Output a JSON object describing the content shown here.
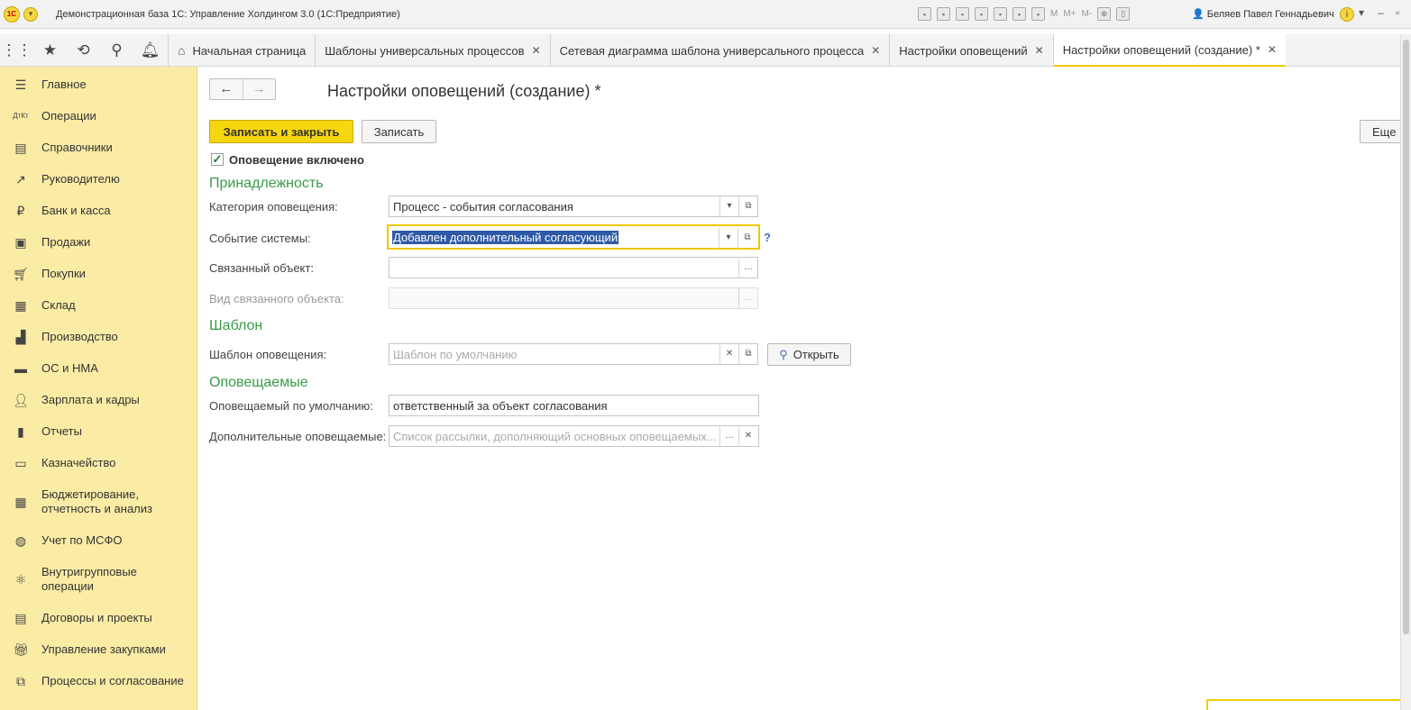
{
  "app": {
    "title": "Демонстрационная база 1С: Управление Холдингом 3.0  (1С:Предприятие)",
    "user": "Беляев Павел Геннадьевич",
    "logo_text": "1С",
    "toolbar_m": [
      "M",
      "M+",
      "M-"
    ]
  },
  "tabs": [
    {
      "label": "Начальная страница"
    },
    {
      "label": "Шаблоны универсальных процессов"
    },
    {
      "label": "Сетевая диаграмма шаблона универсального процесса"
    },
    {
      "label": "Настройки оповещений"
    },
    {
      "label": "Настройки оповещений (создание) *"
    }
  ],
  "sidebar": {
    "items": [
      {
        "label": "Главное",
        "icon": "menu-icon"
      },
      {
        "label": "Операции",
        "icon": "dt-kt-icon"
      },
      {
        "label": "Справочники",
        "icon": "book-icon"
      },
      {
        "label": "Руководителю",
        "icon": "trend-icon"
      },
      {
        "label": "Банк и касса",
        "icon": "ruble-icon"
      },
      {
        "label": "Продажи",
        "icon": "bag-icon"
      },
      {
        "label": "Покупки",
        "icon": "cart-icon"
      },
      {
        "label": "Склад",
        "icon": "warehouse-icon"
      },
      {
        "label": "Производство",
        "icon": "factory-icon"
      },
      {
        "label": "ОС и НМА",
        "icon": "truck-icon"
      },
      {
        "label": "Зарплата и кадры",
        "icon": "person-icon"
      },
      {
        "label": "Отчеты",
        "icon": "bar-chart-icon"
      },
      {
        "label": "Казначейство",
        "icon": "treasury-icon"
      },
      {
        "label": "Бюджетирование,\nотчетность и анализ",
        "icon": "calculator-icon"
      },
      {
        "label": "Учет по МСФО",
        "icon": "globe-icon"
      },
      {
        "label": "Внутригрупповые\nоперации",
        "icon": "atom-icon"
      },
      {
        "label": "Договоры и проекты",
        "icon": "briefcase-icon"
      },
      {
        "label": "Управление закупками",
        "icon": "gift-icon"
      },
      {
        "label": "Процессы и согласование",
        "icon": "flow-icon"
      }
    ]
  },
  "form": {
    "title": "Настройки оповещений (создание) *",
    "save_close_label": "Записать и закрыть",
    "save_label": "Записать",
    "more_label": "Еще",
    "enabled_label": "Оповещение включено",
    "enabled_checked": true,
    "group_belonging": "Принадлежность",
    "category_label": "Категория оповещения:",
    "category_value": "Процесс - события согласования",
    "event_label": "Событие системы:",
    "event_value": "Добавлен дополнительный согласующий",
    "related_object_label": "Связанный объект:",
    "related_object_value": "",
    "related_type_label": "Вид связанного объекта:",
    "related_type_value": "",
    "group_template": "Шаблон",
    "template_label": "Шаблон оповещения:",
    "template_placeholder": "Шаблон по умолчанию",
    "open_label": "Открыть",
    "group_recipients": "Оповещаемые",
    "default_recipient_label": "Оповещаемый по умолчанию:",
    "default_recipient_value": "ответственный за объект согласования",
    "extra_recipients_label": "Дополнительные оповещаемые:",
    "extra_recipients_placeholder": "Список рассылки, дополняющий основных оповещаемых..."
  },
  "colors": {
    "accent": "#f6d60e",
    "sidebar": "#fbeca5",
    "group": "#3a9a4a"
  }
}
